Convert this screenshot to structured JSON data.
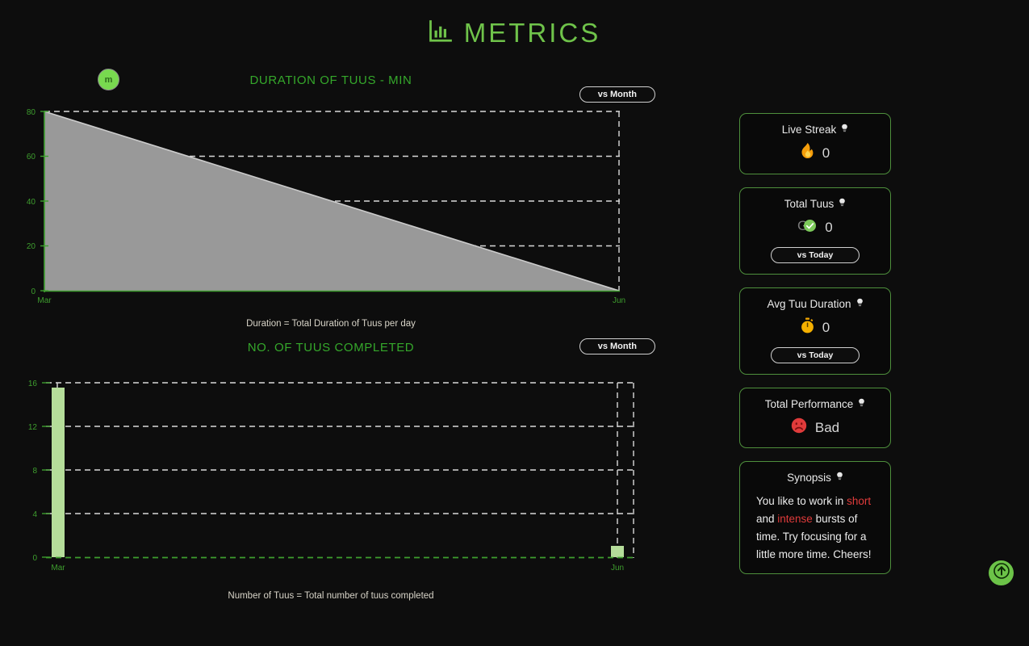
{
  "header": {
    "title": "METRICS",
    "icon": "bar-chart-icon"
  },
  "avatar": {
    "initial": "m"
  },
  "charts": [
    {
      "title": "DURATION OF TUUS - MIN",
      "range_button": "vs Month",
      "caption": "Duration = Total Duration of Tuus per day"
    },
    {
      "title": "NO. OF TUUS COMPLETED",
      "range_button": "vs Month",
      "caption": "Number of Tuus = Total number of tuus completed"
    }
  ],
  "sidebar": {
    "cards": [
      {
        "title": "Live Streak",
        "icon": "flame-icon",
        "value": "0",
        "info_icon": "lightbulb-icon"
      },
      {
        "title": "Total Tuus",
        "icon": "check-circle-icon",
        "value": "0",
        "button": "vs Today",
        "info_icon": "lightbulb-icon"
      },
      {
        "title": "Avg Tuu Duration",
        "icon": "stopwatch-icon",
        "value": "0",
        "button": "vs Today",
        "info_icon": "lightbulb-icon"
      },
      {
        "title": "Total Performance",
        "icon": "frowning-face-icon",
        "value": "Bad",
        "info_icon": "lightbulb-icon"
      }
    ],
    "synopsis": {
      "title": "Synopsis",
      "info_icon": "lightbulb-icon",
      "text_parts": [
        {
          "t": "You like to work in ",
          "hl": false
        },
        {
          "t": "short",
          "hl": true
        },
        {
          "t": " and ",
          "hl": false
        },
        {
          "t": "intense",
          "hl": true
        },
        {
          "t": " bursts of time. Try focusing for a little more time. Cheers!",
          "hl": false
        }
      ]
    }
  },
  "scroll_top_button": {
    "icon": "arrow-up-circle-icon"
  },
  "colors": {
    "accent_green": "#6fc34a",
    "title_green": "#35a82b",
    "bar_green": "#b5dd9a",
    "area_gray": "#999999",
    "background": "#0d0d0d",
    "card_border": "#4e8f3c",
    "highlight_red": "#e03b3b"
  },
  "chart_data": [
    {
      "type": "area",
      "title": "DURATION OF TUUS - MIN",
      "xlabel": "",
      "ylabel": "",
      "x": [
        "Mar",
        "Jun"
      ],
      "values": [
        80,
        0
      ],
      "ylim": [
        0,
        80
      ],
      "yticks": [
        0,
        20,
        40,
        60,
        80
      ],
      "xticks": [
        "Mar",
        "Jun"
      ],
      "grid": true,
      "legend": "none",
      "caption": "Duration = Total Duration of Tuus per day"
    },
    {
      "type": "bar",
      "title": "NO. OF TUUS COMPLETED",
      "xlabel": "",
      "ylabel": "",
      "categories": [
        "Mar",
        "Jun"
      ],
      "values": [
        15,
        1
      ],
      "ylim": [
        0,
        16
      ],
      "yticks": [
        0,
        4,
        8,
        12,
        16
      ],
      "grid": true,
      "legend": "none",
      "caption": "Number of Tuus = Total number of tuus completed"
    }
  ]
}
